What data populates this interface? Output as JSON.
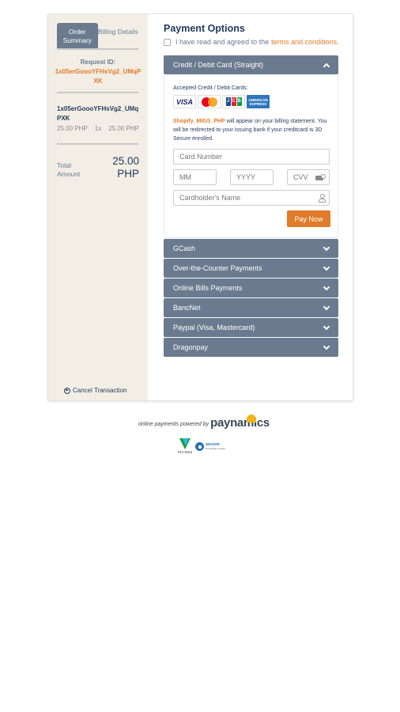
{
  "sidebar": {
    "tabs": [
      {
        "label": "Order Summary",
        "active": true
      },
      {
        "label": "Billing Details",
        "active": false
      }
    ],
    "request_id_label": "Request ID:",
    "request_id": "1x05erGoooYFHsVg2_UMqPXK",
    "item": {
      "name": "1x05erGoooYFHsVg2_UMqPXK",
      "unit_price": "25.00 PHP",
      "quantity": "1x",
      "line_total": "25.00 PHP"
    },
    "total_label": "Total Amount",
    "total_amount": "25.00 PHP",
    "cancel_label": "Cancel Transaction"
  },
  "main": {
    "title": "Payment Options",
    "agree_text": "I have read and agreed to the",
    "agree_link": "terms and conditions.",
    "agree_checked": false,
    "methods": [
      {
        "label": "Credit / Debit Card (Straight)",
        "expanded": true
      },
      {
        "label": "GCash",
        "expanded": false
      },
      {
        "label": "Over-the-Counter Payments",
        "expanded": false
      },
      {
        "label": "Online Bills Payments",
        "expanded": false
      },
      {
        "label": "BancNet",
        "expanded": false
      },
      {
        "label": "Paypal (Visa, Mastercard)",
        "expanded": false
      },
      {
        "label": "Dragonpay",
        "expanded": false
      }
    ],
    "card_form": {
      "accepted_label": "Accepted Credit / Debit Cards:",
      "card_brands": [
        "VISA",
        "Mastercard",
        "JCB",
        "American Express"
      ],
      "visa_text": "VISA",
      "amex_text": "AMERICAN EXPRESS",
      "merchant": "Shopify_MIGS_PHP",
      "billing_text": "will appear on your billing statement. You will be redirected to your issuing bank if your creditcard is 3D Secure enrolled.",
      "card_number_placeholder": "Card Number",
      "month_placeholder": "MM",
      "year_placeholder": "YYYY",
      "cvv_placeholder": "CVV",
      "name_placeholder": "Cardholder's Name",
      "pay_label": "Pay Now"
    }
  },
  "footer": {
    "powered_text": "online payments powered by",
    "brand": "paynamics",
    "pci_label": "PCI-DSS",
    "secure_label": "secure",
    "secure_sub": "Knowledge Leader"
  },
  "colors": {
    "accent": "#e07b29",
    "header": "#6b7a8f",
    "navy": "#1f3a5c",
    "sidebar_bg": "#f3eee5"
  }
}
